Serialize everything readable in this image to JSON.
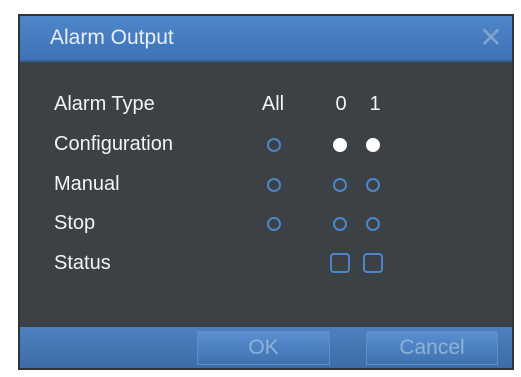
{
  "dialog": {
    "title": "Alarm Output",
    "close_symbol": "✕"
  },
  "grid": {
    "header_label": "Alarm Type",
    "column_headers": [
      "All",
      "0",
      "1"
    ],
    "rows": [
      {
        "label": "Configuration",
        "all": false,
        "ch0": true,
        "ch1": true
      },
      {
        "label": "Manual",
        "all": false,
        "ch0": false,
        "ch1": false
      },
      {
        "label": "Stop",
        "all": false,
        "ch0": false,
        "ch1": false
      }
    ],
    "status_label": "Status"
  },
  "buttons": {
    "ok_label": "OK",
    "cancel_label": "Cancel"
  },
  "colors": {
    "titlebar": "#4f86c9",
    "panel": "#3c4145",
    "accent": "#4b87c8"
  },
  "icons": {
    "close": "close-icon"
  }
}
